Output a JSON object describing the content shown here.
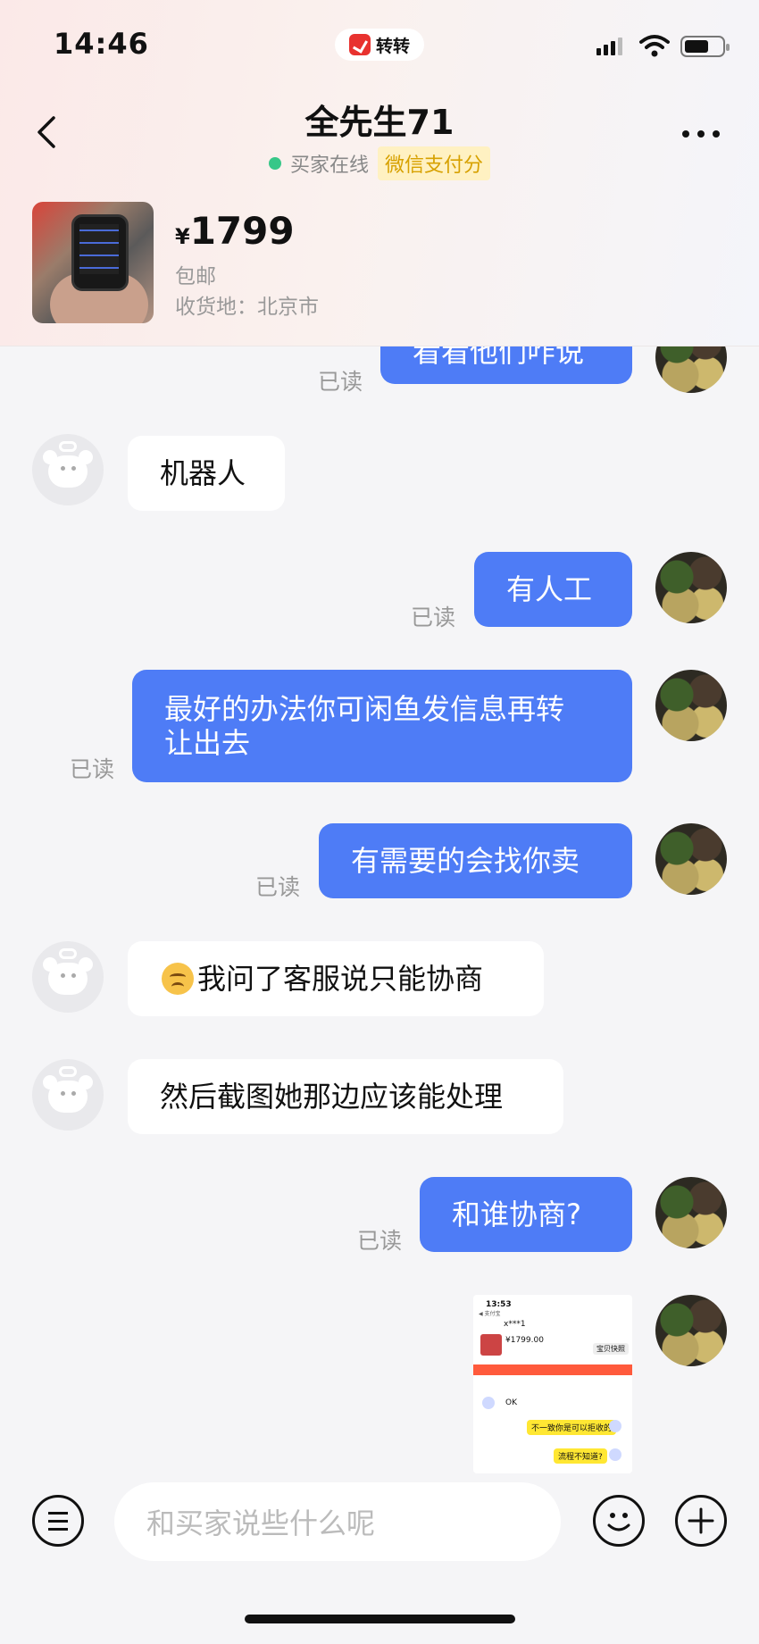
{
  "status_bar": {
    "time": "14:46",
    "app_name": "转转"
  },
  "header": {
    "title": "全先生71",
    "online_status": "买家在线",
    "badge": "微信支付分"
  },
  "product": {
    "currency": "¥",
    "price": "1799",
    "shipping": "包邮",
    "ship_to": "收货地：北京市"
  },
  "messages": {
    "m0": {
      "text": "看看他们咋说",
      "read": "已读"
    },
    "m1": {
      "text": "机器人"
    },
    "m2": {
      "text": "有人工",
      "read": "已读"
    },
    "m3": {
      "line1": "最好的办法你可闲鱼发信息再转",
      "line2": "让出去",
      "read": "已读"
    },
    "m4": {
      "text": "有需要的会找你卖",
      "read": "已读"
    },
    "m5": {
      "text": "我问了客服说只能协商"
    },
    "m6": {
      "text": "然后截图她那边应该能处理"
    },
    "m7": {
      "text": "和谁协商?",
      "read": "已读"
    },
    "m8": {
      "shot_time": "13:53",
      "shot_back": "◀ 支付宝",
      "shot_title": "x***1",
      "shot_price": "¥1799.00",
      "shot_button": "宝贝快照",
      "shot_ok": "OK",
      "shot_bubble1": "不一致你是可以拒收的",
      "shot_bubble2": "流程不知道?"
    }
  },
  "input": {
    "placeholder": "和买家说些什么呢"
  },
  "colors": {
    "accent": "#4e7cf6",
    "online": "#37c788",
    "badge_bg": "#fff1c2"
  }
}
